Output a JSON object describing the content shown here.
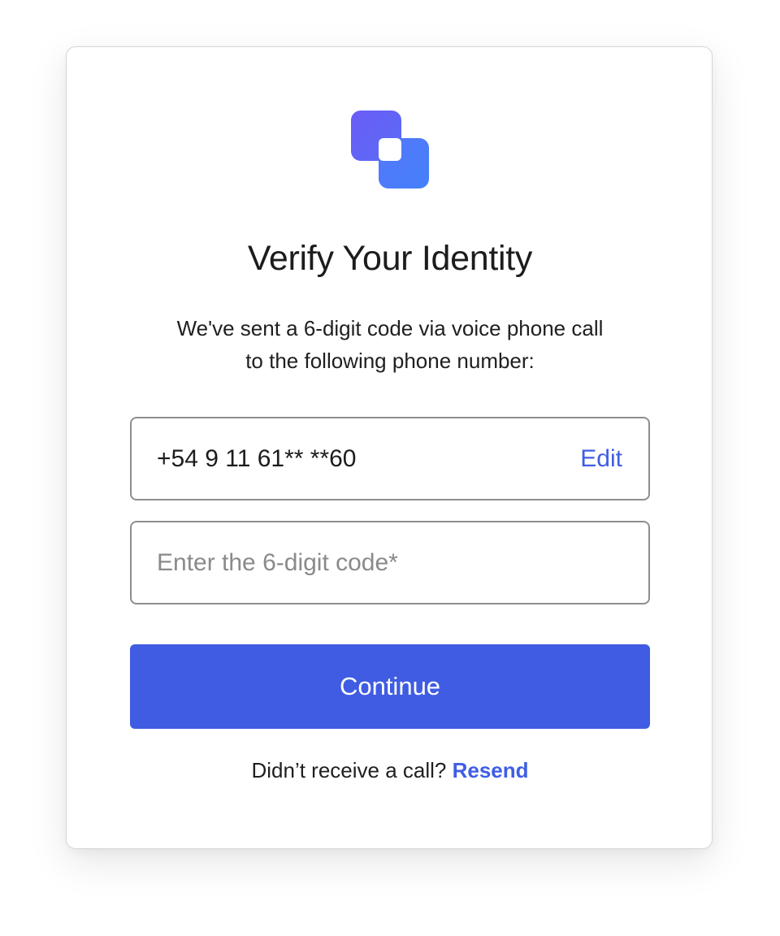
{
  "logo": {
    "icon": "brand-logo-icon",
    "color_top": "#6366f5",
    "color_bottom": "#4a7ef7"
  },
  "header": {
    "title": "Verify Your Identity"
  },
  "description": {
    "line1": "We've sent a 6-digit code via voice phone call",
    "line2": "to the following phone number:"
  },
  "phone": {
    "value": "+54 9 11 61** **60",
    "edit_label": "Edit"
  },
  "code_field": {
    "value": "",
    "placeholder": "Enter the 6-digit code*"
  },
  "continue_label": "Continue",
  "resend": {
    "prompt": "Didn’t receive a call?",
    "link_label": "Resend"
  },
  "colors": {
    "accent": "#3f5ce2",
    "link": "#3f5ee3",
    "border": "#8e8e8e"
  }
}
